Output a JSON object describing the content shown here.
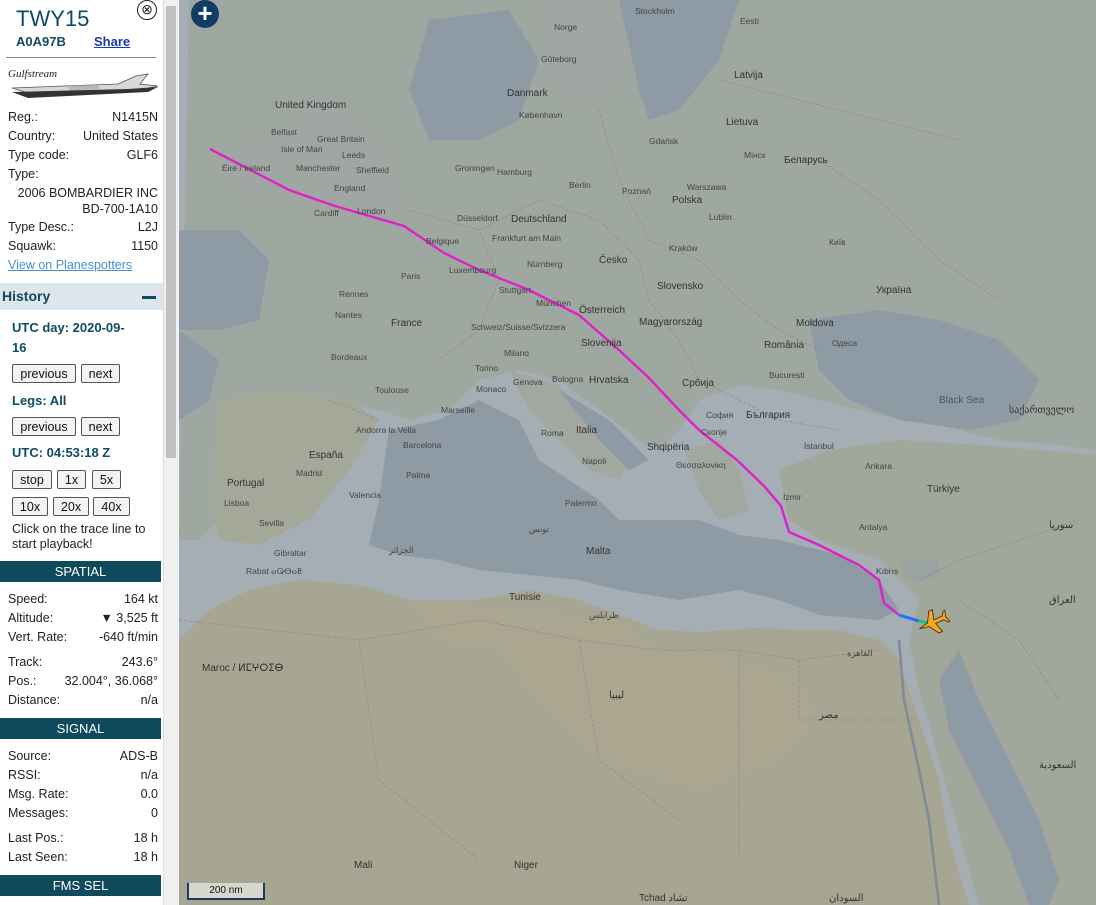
{
  "aircraft": {
    "callsign": "TWY15",
    "hex": "A0A97B",
    "share_label": "Share",
    "close_glyph": "⊗",
    "logo_text": "Gulfstream"
  },
  "details": [
    {
      "label": "Reg.:",
      "value": "N1415N"
    },
    {
      "label": "Country:",
      "value": "United States"
    },
    {
      "label": "Type code:",
      "value": "GLF6"
    },
    {
      "label": "Type:",
      "value": ""
    }
  ],
  "type_full": [
    "2006 BOMBARDIER INC",
    "BD-700-1A10"
  ],
  "details2": [
    {
      "label": "Type Desc.:",
      "value": "L2J"
    },
    {
      "label": "Squawk:",
      "value": "1150"
    }
  ],
  "planespotters_link": "View on Planespotters",
  "history": {
    "title": "History",
    "utc_day_line1": "UTC day: 2020-09-",
    "utc_day_line2": "16",
    "previous": "previous",
    "next": "next",
    "legs": "Legs: All",
    "utc_time": "UTC: 04:53:18 Z",
    "stop": "stop",
    "speeds": [
      "1x",
      "5x",
      "10x",
      "20x",
      "40x"
    ],
    "hint": "Click on the trace line to start playback!"
  },
  "spatial": {
    "title": "SPATIAL",
    "rows": [
      {
        "label": "Speed:",
        "value": "164 kt"
      },
      {
        "label": "Altitude:",
        "value": "▼ 3,525 ft"
      },
      {
        "label": "Vert. Rate:",
        "value": "-640 ft/min"
      },
      {
        "label": "Track:",
        "value": "243.6°"
      },
      {
        "label": "Pos.:",
        "value": "32.004°, 36.068°"
      },
      {
        "label": "Distance:",
        "value": "n/a"
      }
    ]
  },
  "signal": {
    "title": "SIGNAL",
    "rows": [
      {
        "label": "Source:",
        "value": "ADS-B"
      },
      {
        "label": "RSSI:",
        "value": "n/a"
      },
      {
        "label": "Msg. Rate:",
        "value": "0.0"
      },
      {
        "label": "Messages:",
        "value": "0"
      },
      {
        "label": "Last Pos.:",
        "value": "18 h"
      },
      {
        "label": "Last Seen:",
        "value": "18 h"
      }
    ]
  },
  "fms_title": "FMS SEL",
  "map": {
    "zoom_in": "+",
    "scale_label": "200 nm",
    "track_color": "#e020c8",
    "aircraft_color": "#f5a623",
    "labels": {
      "norway": "Norge",
      "stockholm": "Stockholm",
      "eesti": "Eesti",
      "latvija": "Latvija",
      "lietuva": "Lietuva",
      "uk": "United Kingdom",
      "great_britain": "Great Britain",
      "eire": "Éire / Ireland",
      "belfast": "Belfast",
      "isle_of_man": "Isle of Man",
      "manchester": "Manchester",
      "leeds": "Leeds",
      "sheffield": "Sheffield",
      "cardiff": "Cardiff",
      "london": "London",
      "england": "England",
      "danmark": "Danmark",
      "kobenhavn": "København",
      "goteborg": "Göteborg",
      "hamburg": "Hamburg",
      "groningen": "Groningen",
      "berlin": "Berlin",
      "deutschland": "Deutschland",
      "dusseldorf": "Düsseldorf",
      "belgique": "Belgique",
      "frankfurt": "Frankfurt am Main",
      "nurnberg": "Nürnberg",
      "luxembourg": "Luxembourg",
      "paris": "Paris",
      "france": "France",
      "rennes": "Rennes",
      "nantes": "Nantes",
      "stuttgart": "Stuttgart",
      "munchen": "München",
      "osterreich": "Österreich",
      "cesko": "Česko",
      "polska": "Polska",
      "poznan": "Poznań",
      "gdansk": "Gdańsk",
      "warszawa": "Warszawa",
      "krakow": "Kraków",
      "lublin": "Lublin",
      "slovensko": "Slovensko",
      "magyarorszag": "Magyarország",
      "schweiz": "Schweiz/Suisse/Svizzera",
      "milano": "Milano",
      "torino": "Torino",
      "genova": "Genova",
      "bologna": "Bologna",
      "monaco": "Monaco",
      "marseille": "Marseille",
      "bordeaux": "Bordeaux",
      "toulouse": "Toulouse",
      "andorra": "Andorra la Vella",
      "barcelona": "Barcelona",
      "espana": "España",
      "madrid": "Madrid",
      "portugal": "Portugal",
      "lisboa": "Lisboa",
      "sevilla": "Sevilla",
      "valencia": "Valencia",
      "palma": "Palma",
      "italia": "Italia",
      "roma": "Roma",
      "napoli": "Napoli",
      "palermo": "Palermo",
      "hrvatska": "Hrvatska",
      "slovenija": "Slovenija",
      "srbija": "Србија",
      "romania": "România",
      "bucuresti": "București",
      "bulgaria": "България",
      "sofia": "София",
      "skopje": "Скопје",
      "shqiperia": "Shqipëria",
      "thessaloniki": "Θεσσαλονίκη",
      "istanbul": "İstanbul",
      "ankara": "Ankara",
      "turkiye": "Türkiye",
      "izmir": "İzmir",
      "antalya": "Antalya",
      "kibris": "Kıbrıs",
      "moldova": "Moldova",
      "ukraina": "Україна",
      "kyiv": "Київ",
      "odesa": "Одеса",
      "belarus": "Беларусь",
      "minsk": "Мінск",
      "black_sea": "Black Sea",
      "malta": "Malta",
      "tunis": "تونس",
      "alger": "الجزائر",
      "tripoli": "طرابلس",
      "libya": "ليبيا",
      "cairo": "القاهرة",
      "egypt": "مصر",
      "sakartvelo": "საქართველო",
      "syria": "سوريا",
      "iraq": "العراق",
      "saudi": "السعودية",
      "niger": "Niger",
      "mali": "Mali",
      "tchad": "Tchad تشاد",
      "sudan": "السودان",
      "maroc": "Maroc / ⵍⵎⵖⵔⵉⴱ",
      "rabat": "Rabat ⴰⵕⴱⴰⵟ",
      "gibraltar": "Gibraltar",
      "tunisie": "Tunisie"
    }
  }
}
